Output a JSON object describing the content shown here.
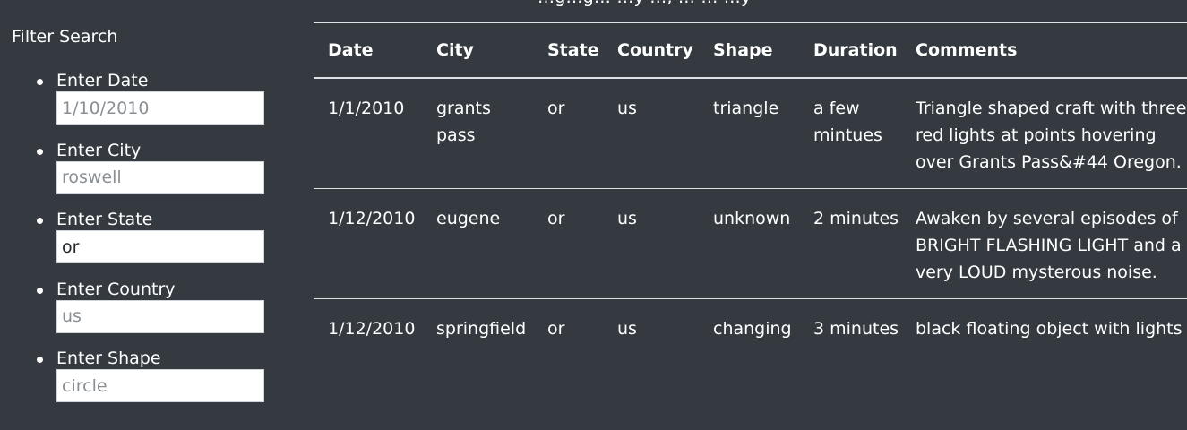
{
  "top_text": "…g…g…   …y   …,   …   …   …y",
  "filters": {
    "title": "Filter Search",
    "fields": [
      {
        "label": "Enter Date",
        "placeholder": "1/10/2010",
        "value": ""
      },
      {
        "label": "Enter City",
        "placeholder": "roswell",
        "value": ""
      },
      {
        "label": "Enter State",
        "placeholder": "",
        "value": "or"
      },
      {
        "label": "Enter Country",
        "placeholder": "us",
        "value": ""
      },
      {
        "label": "Enter Shape",
        "placeholder": "circle",
        "value": ""
      }
    ]
  },
  "table": {
    "headers": [
      "Date",
      "City",
      "State",
      "Country",
      "Shape",
      "Duration",
      "Comments"
    ],
    "rows": [
      {
        "date": "1/1/2010",
        "city": "grants pass",
        "state": "or",
        "country": "us",
        "shape": "triangle",
        "duration": "a few mintues",
        "comments": "Triangle shaped craft with three red lights at points hovering over Grants Pass&#44 Oregon."
      },
      {
        "date": "1/12/2010",
        "city": "eugene",
        "state": "or",
        "country": "us",
        "shape": "unknown",
        "duration": "2 minutes",
        "comments": "Awaken by several episodes of BRIGHT FLASHING LIGHT and a very LOUD mysterous noise."
      },
      {
        "date": "1/12/2010",
        "city": "springfield",
        "state": "or",
        "country": "us",
        "shape": "changing",
        "duration": "3 minutes",
        "comments": "black floating object with lights"
      }
    ]
  }
}
